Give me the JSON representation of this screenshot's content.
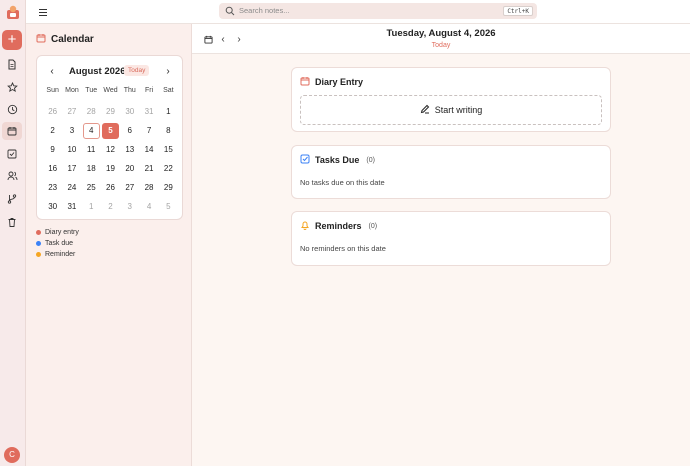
{
  "app": {
    "new_button_label": "+",
    "user_initial": "C",
    "nav_icons": [
      "notes-icon",
      "star-icon",
      "clock-icon",
      "calendar-icon",
      "check-icon",
      "people-icon",
      "branch-icon",
      "trash-icon"
    ],
    "active_nav": "calendar-icon",
    "accent_color": "#e06c5d"
  },
  "search": {
    "placeholder": "Search notes...",
    "shortcut": "Ctrl+K"
  },
  "sidebar": {
    "title": "Calendar",
    "calendar": {
      "month_label": "August 2026",
      "today_label": "Today",
      "weekdays": [
        "Sun",
        "Mon",
        "Tue",
        "Wed",
        "Thu",
        "Fri",
        "Sat"
      ],
      "days": [
        {
          "n": "26",
          "m": true
        },
        {
          "n": "27",
          "m": true
        },
        {
          "n": "28",
          "m": true
        },
        {
          "n": "29",
          "m": true
        },
        {
          "n": "30",
          "m": true
        },
        {
          "n": "31",
          "m": true
        },
        {
          "n": "1"
        },
        {
          "n": "2"
        },
        {
          "n": "3"
        },
        {
          "n": "4",
          "sel": true
        },
        {
          "n": "5",
          "today": true
        },
        {
          "n": "6"
        },
        {
          "n": "7"
        },
        {
          "n": "8"
        },
        {
          "n": "9"
        },
        {
          "n": "10"
        },
        {
          "n": "11"
        },
        {
          "n": "12"
        },
        {
          "n": "13"
        },
        {
          "n": "14"
        },
        {
          "n": "15"
        },
        {
          "n": "16"
        },
        {
          "n": "17"
        },
        {
          "n": "18"
        },
        {
          "n": "19"
        },
        {
          "n": "20"
        },
        {
          "n": "21"
        },
        {
          "n": "22"
        },
        {
          "n": "23"
        },
        {
          "n": "24"
        },
        {
          "n": "25"
        },
        {
          "n": "26"
        },
        {
          "n": "27"
        },
        {
          "n": "28"
        },
        {
          "n": "29"
        },
        {
          "n": "30"
        },
        {
          "n": "31"
        },
        {
          "n": "1",
          "m": true
        },
        {
          "n": "2",
          "m": true
        },
        {
          "n": "3",
          "m": true
        },
        {
          "n": "4",
          "m": true
        },
        {
          "n": "5",
          "m": true
        }
      ]
    },
    "legend": [
      {
        "label": "Diary entry",
        "color": "#e06c5d"
      },
      {
        "label": "Task due",
        "color": "#3b82f6"
      },
      {
        "label": "Reminder",
        "color": "#f5a623"
      }
    ]
  },
  "main": {
    "date_title": "Tuesday, August 4, 2026",
    "today_link": "Today",
    "diary": {
      "title": "Diary Entry",
      "start_label": "Start writing"
    },
    "tasks": {
      "title": "Tasks Due",
      "count": "(0)",
      "empty": "No tasks due on this date"
    },
    "reminders": {
      "title": "Reminders",
      "count": "(0)",
      "empty": "No reminders on this date"
    }
  }
}
